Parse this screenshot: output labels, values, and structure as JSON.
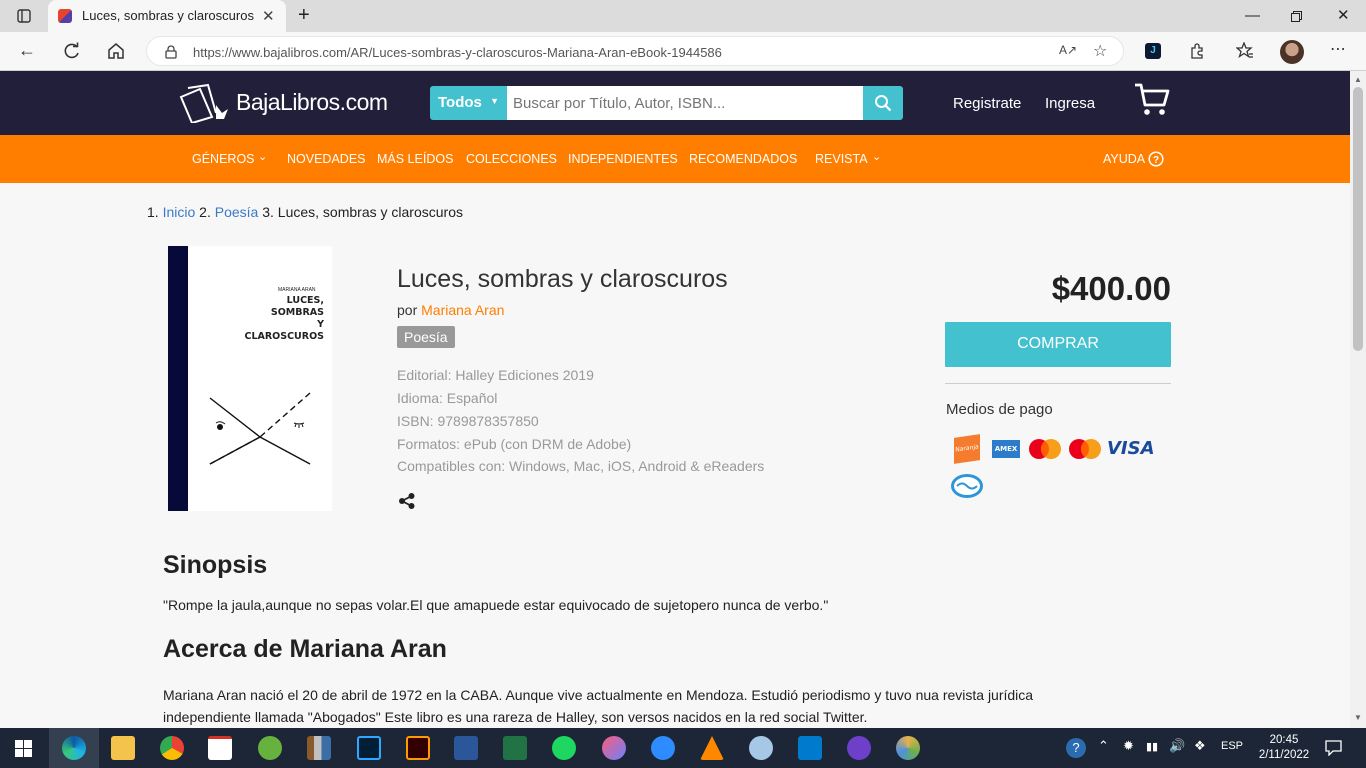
{
  "browser": {
    "tab_title": "Luces, sombras y claroscuros de",
    "url": "https://www.bajalibros.com/AR/Luces-sombras-y-claroscuros-Mariana-Aran-eBook-1944586",
    "new_tab": "+",
    "close": "✕"
  },
  "header": {
    "logo_text": "BajaLibros.com",
    "search_category": "Todos",
    "search_placeholder": "Buscar por Título, Autor, ISBN...",
    "register": "Registrate",
    "login": "Ingresa"
  },
  "nav": {
    "items": [
      "GÉNEROS",
      "NOVEDADES",
      "MÁS LEÍDOS",
      "COLECCIONES",
      "INDEPENDIENTES",
      "RECOMENDADOS",
      "REVISTA"
    ],
    "help": "AYUDA"
  },
  "breadcrumb": {
    "n1": "1.",
    "item1": "Inicio",
    "n2": "2.",
    "item2": "Poesía",
    "n3": "3.",
    "item3": "Luces, sombras y claroscuros"
  },
  "cover": {
    "author": "MARIANA ARAN",
    "title_line1": "LUCES, SOMBRAS",
    "title_line2": "Y CLAROSCUROS"
  },
  "book": {
    "title": "Luces, sombras y claroscuros",
    "by": "por",
    "author": "Mariana Aran",
    "genre": "Poesía",
    "editorial": "Editorial: Halley Ediciones 2019",
    "idioma": "Idioma: Español",
    "isbn": "ISBN: 9789878357850",
    "formatos": "Formatos: ePub (con DRM de Adobe)",
    "compatibles": "Compatibles con: Windows, Mac, iOS, Android & eReaders"
  },
  "purchase": {
    "price": "$400.00",
    "buy_label": "COMPRAR",
    "payment_title": "Medios de pago",
    "naranja": "Naranja",
    "amex": "AMEX",
    "visa": "VISA"
  },
  "sinopsis": {
    "heading": "Sinopsis",
    "text": "\"Rompe la jaula,aunque no sepas volar.El que amapuede estar equivocado de sujetopero nunca de verbo.\""
  },
  "about": {
    "heading": "Acerca de Mariana Aran",
    "text": "Mariana Aran nació el 20 de abril de 1972 en la CABA. Aunque vive actualmente en Mendoza. Estudió periodismo y tuvo nua revista jurídica independiente llamada \"Abogados\" Este libro es una rareza de Halley, son versos nacidos en la red social Twitter."
  },
  "taskbar": {
    "lang": "ESP",
    "time": "20:45",
    "date": "2/11/2022"
  },
  "colors": {
    "header_bg": "#221f3b",
    "nav_orange": "#ff7e00",
    "accent_teal": "#43c1cf",
    "link_blue": "#3a7bc8"
  }
}
